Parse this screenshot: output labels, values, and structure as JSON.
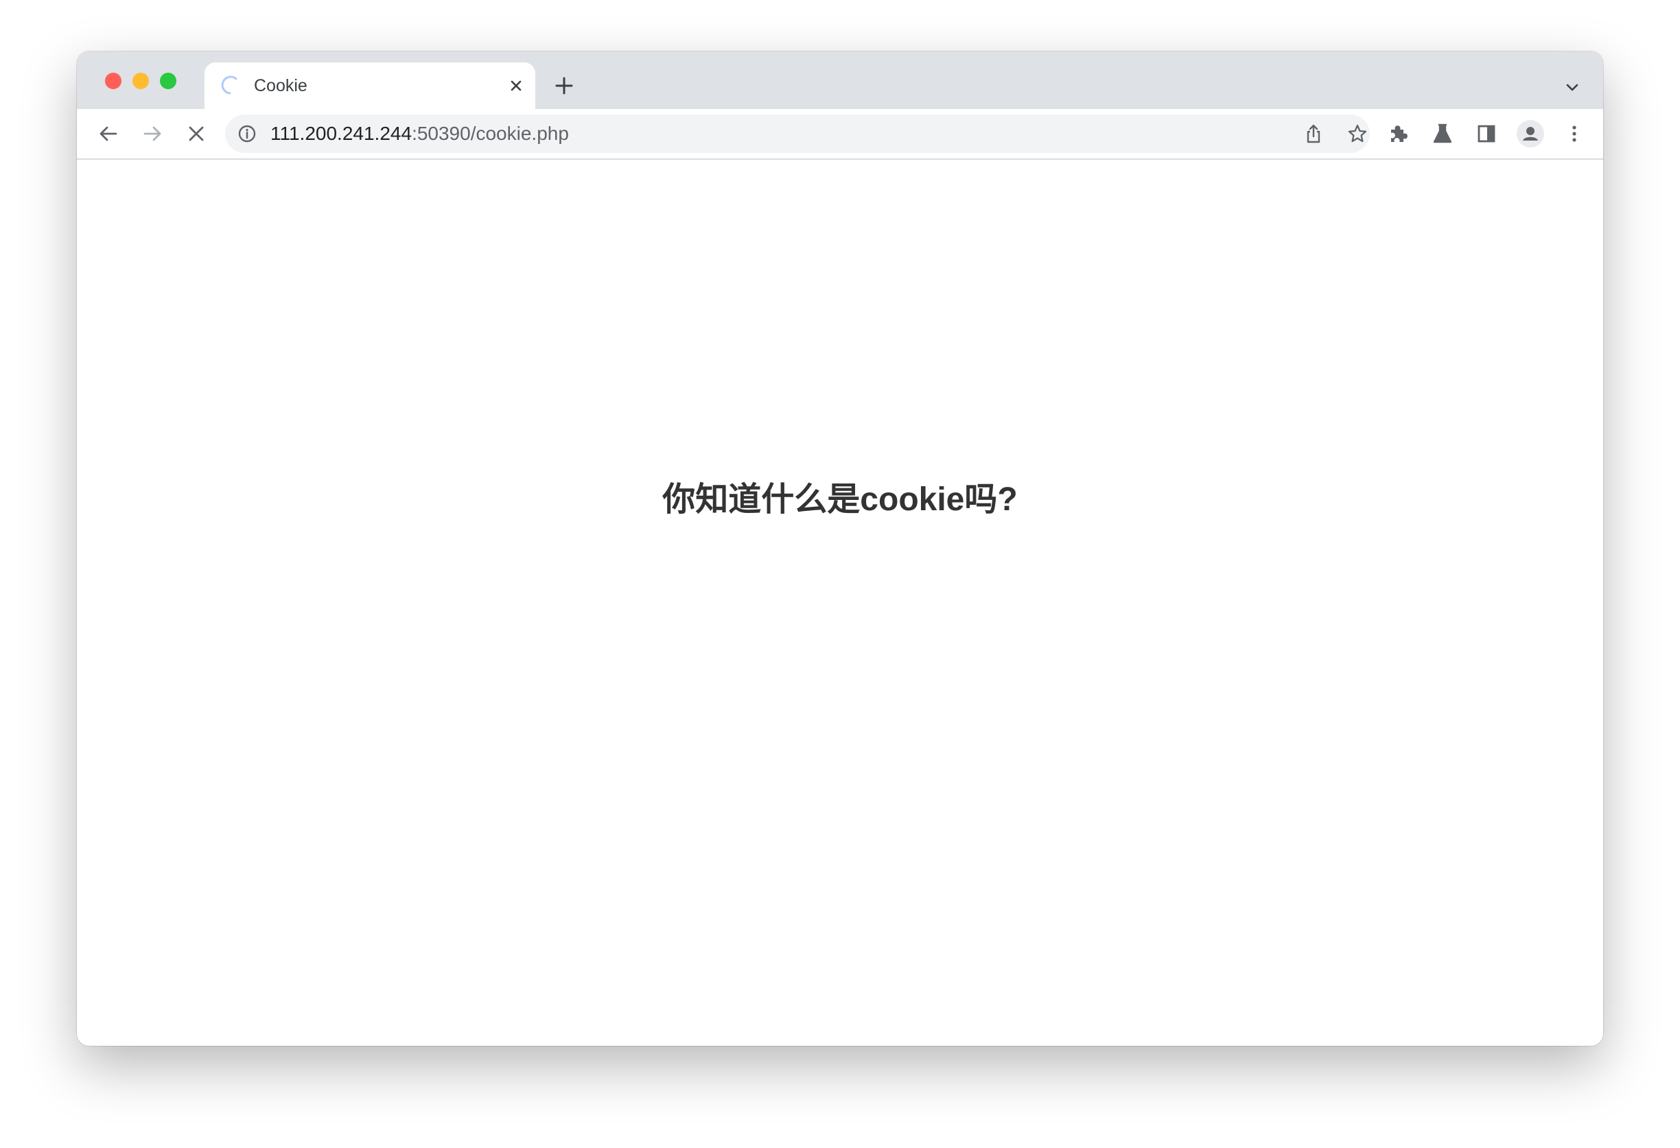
{
  "browser": {
    "tab": {
      "title": "Cookie"
    },
    "address": {
      "host": "111.200.241.244",
      "rest": ":50390/cookie.php"
    }
  },
  "page": {
    "heading": "你知道什么是cookie吗?"
  },
  "colors": {
    "tabstrip": "#dee1e6",
    "omnibox": "#f1f3f4",
    "icon": "#5f6368",
    "heading_text": "#333333",
    "traffic_red": "#ff5f57",
    "traffic_yellow": "#febc2e",
    "traffic_green": "#28c840"
  },
  "icons": {
    "tab": [
      "loading-spinner-icon",
      "close-icon",
      "plus-icon",
      "chevron-down-icon"
    ],
    "toolbar": [
      "arrow-left-icon",
      "arrow-right-icon",
      "stop-icon",
      "info-icon",
      "share-icon",
      "star-icon",
      "puzzle-icon",
      "flask-icon",
      "side-panel-icon",
      "avatar-icon",
      "kebab-menu-icon"
    ]
  }
}
